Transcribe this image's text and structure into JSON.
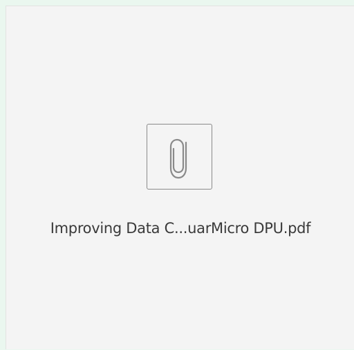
{
  "attachment": {
    "filename": "Improving Data C...uarMicro DPU.pdf",
    "icon": "paperclip-icon",
    "colors": {
      "background": "#f4f4f4",
      "outer": "#eaf7ef",
      "icon_stroke": "#8a8a8a",
      "text": "#3a3a3a"
    }
  }
}
